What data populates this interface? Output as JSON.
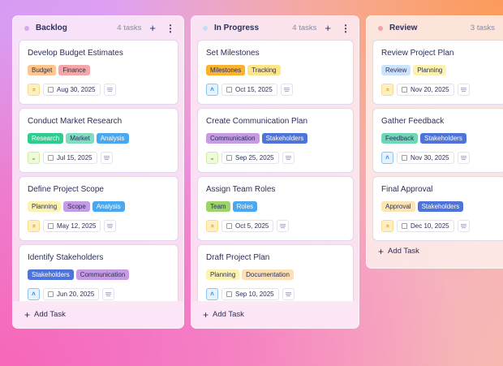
{
  "columns": [
    {
      "title": "Backlog",
      "count": "4 tasks",
      "dot": "#d8a6f3",
      "add_task": "Add Task",
      "cards": [
        {
          "title": "Develop Budget Estimates",
          "priority": "urgent",
          "date": "Aug 30, 2025",
          "tags": [
            {
              "label": "Budget",
              "bg": "#fdc68e",
              "fg": "#3a2f3a"
            },
            {
              "label": "Finance",
              "bg": "#f3a7a8",
              "fg": "#3a2f3a"
            }
          ]
        },
        {
          "title": "Conduct Market Research",
          "priority": "low",
          "date": "Jul 15, 2025",
          "tags": [
            {
              "label": "Research",
              "bg": "#2fcc8f",
              "fg": "#ffffff"
            },
            {
              "label": "Market",
              "bg": "#7fdcbf",
              "fg": "#2b2f5a"
            },
            {
              "label": "Analysis",
              "bg": "#4aa8f0",
              "fg": "#ffffff"
            }
          ]
        },
        {
          "title": "Define Project Scope",
          "priority": "urgent",
          "date": "May 12, 2025",
          "tags": [
            {
              "label": "Planning",
              "bg": "#fdf3b0",
              "fg": "#2b2f5a"
            },
            {
              "label": "Scope",
              "bg": "#c49be6",
              "fg": "#2b2f5a"
            },
            {
              "label": "Analysis",
              "bg": "#4aa8f0",
              "fg": "#ffffff"
            }
          ]
        },
        {
          "title": "Identify Stakeholders",
          "priority": "medium",
          "date": "Jun 20, 2025",
          "tags": [
            {
              "label": "Stakeholders",
              "bg": "#4f74d9",
              "fg": "#ffffff"
            },
            {
              "label": "Communication",
              "bg": "#c79be3",
              "fg": "#2b2f5a"
            }
          ]
        }
      ]
    },
    {
      "title": "In Progress",
      "count": "4 tasks",
      "dot": "#bfe0fb",
      "add_task": "Add Task",
      "cards": [
        {
          "title": "Set Milestones",
          "priority": "medium",
          "date": "Oct 15, 2025",
          "tags": [
            {
              "label": "Milestones",
              "bg": "#fbb22d",
              "fg": "#2b2f5a"
            },
            {
              "label": "Tracking",
              "bg": "#fde68a",
              "fg": "#2b2f5a"
            }
          ]
        },
        {
          "title": "Create Communication Plan",
          "priority": "low",
          "date": "Sep 25, 2025",
          "tags": [
            {
              "label": "Communication",
              "bg": "#c79be3",
              "fg": "#2b2f5a"
            },
            {
              "label": "Stakeholders",
              "bg": "#4f74d9",
              "fg": "#ffffff"
            }
          ]
        },
        {
          "title": "Assign Team Roles",
          "priority": "urgent",
          "date": "Oct 5, 2025",
          "tags": [
            {
              "label": "Team",
              "bg": "#9cd46a",
              "fg": "#2b2f5a"
            },
            {
              "label": "Roles",
              "bg": "#4aa8f0",
              "fg": "#ffffff"
            }
          ]
        },
        {
          "title": "Draft Project Plan",
          "priority": "medium",
          "date": "Sep 10, 2025",
          "tags": [
            {
              "label": "Planning",
              "bg": "#fdf3b0",
              "fg": "#2b2f5a"
            },
            {
              "label": "Documentation",
              "bg": "#fde0b5",
              "fg": "#2b2f5a"
            }
          ]
        }
      ]
    },
    {
      "title": "Review",
      "count": "3 tasks",
      "dot": "#f4a0a8",
      "add_task": "Add Task",
      "cards": [
        {
          "title": "Review Project Plan",
          "priority": "urgent",
          "date": "Nov 20, 2025",
          "tags": [
            {
              "label": "Review",
              "bg": "#cce4fb",
              "fg": "#2b2f5a"
            },
            {
              "label": "Planning",
              "bg": "#fdf3b0",
              "fg": "#2b2f5a"
            }
          ]
        },
        {
          "title": "Gather Feedback",
          "priority": "medium",
          "date": "Nov 30, 2025",
          "tags": [
            {
              "label": "Feedback",
              "bg": "#6fd7b5",
              "fg": "#2b2f5a"
            },
            {
              "label": "Stakeholders",
              "bg": "#4f74d9",
              "fg": "#ffffff"
            }
          ]
        },
        {
          "title": "Final Approval",
          "priority": "urgent",
          "date": "Dec 10, 2025",
          "tags": [
            {
              "label": "Approval",
              "bg": "#fde6b5",
              "fg": "#2b2f5a"
            },
            {
              "label": "Stakeholders",
              "bg": "#4f74d9",
              "fg": "#ffffff"
            }
          ]
        }
      ]
    }
  ]
}
